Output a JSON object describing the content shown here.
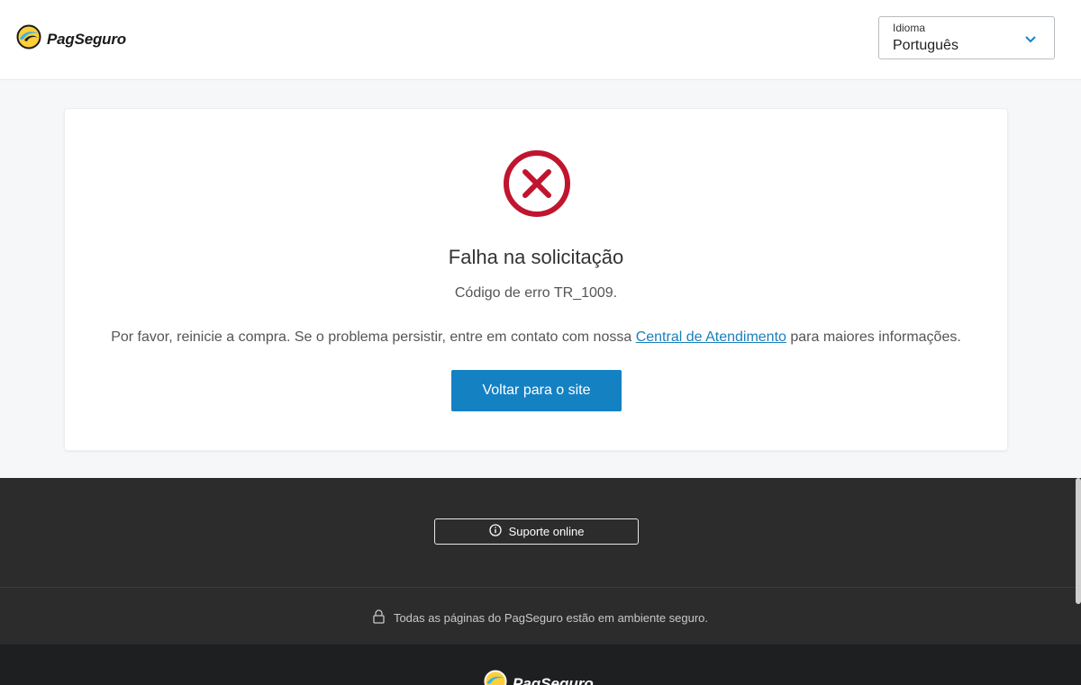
{
  "header": {
    "logo_text": "PagSeguro",
    "language": {
      "label": "Idioma",
      "value": "Português"
    }
  },
  "card": {
    "title": "Falha na solicitação",
    "error_code": "Código de erro TR_1009.",
    "message_before": "Por favor, reinicie a compra. Se o problema persistir, entre em contato com nossa ",
    "message_link": "Central de Atendimento",
    "message_after": " para maiores informações.",
    "button_label": "Voltar para o site"
  },
  "footer": {
    "support_label": "Suporte online",
    "secure_text": "Todas as páginas do PagSeguro estão em ambiente seguro.",
    "logo_text": "PagSeguro"
  },
  "colors": {
    "error": "#c0152f",
    "primary": "#1481c3",
    "link": "#1a7fbd",
    "footer_bg": "#2c2c2d"
  }
}
